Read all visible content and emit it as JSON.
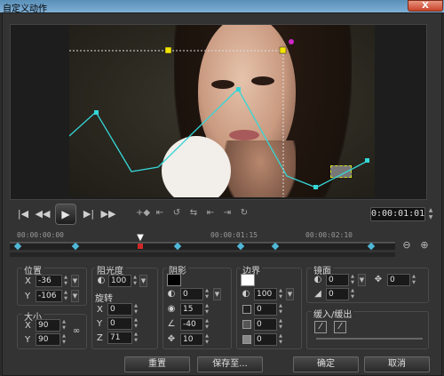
{
  "window": {
    "title": "自定义动作",
    "close_label": "X"
  },
  "transport": {
    "timecode": "0:00:01:01",
    "icons": [
      "skip-to-start-icon",
      "step-back-icon",
      "play-icon",
      "step-forward-icon",
      "skip-to-end-icon"
    ]
  },
  "timeline": {
    "ruler_labels": [
      "00:00:00:00",
      "00:00:01:15",
      "00:00:02:10"
    ],
    "keyframe_count": 8
  },
  "position": {
    "label": "位置",
    "x_axis": "X",
    "y_axis": "Y",
    "x": "-36",
    "y": "-106"
  },
  "size": {
    "label": "大小",
    "x_axis": "X",
    "y_axis": "Y",
    "x": "90",
    "y": "90"
  },
  "opacity": {
    "label": "阻光度",
    "value": "100"
  },
  "rotation": {
    "label": "旋转",
    "x_axis": "X",
    "y_axis": "Y",
    "z_axis": "Z",
    "x": "0",
    "y": "0",
    "z": "71"
  },
  "shadow": {
    "label": "阴影",
    "color": "#000000",
    "values": [
      "0",
      "15",
      "-40",
      "10"
    ]
  },
  "border": {
    "label": "边界",
    "color": "#ffffff",
    "values": [
      "100",
      "0",
      "0",
      "0"
    ]
  },
  "mirror": {
    "label": "镜面",
    "values": [
      "0",
      "0"
    ],
    "side_value": "0"
  },
  "fade": {
    "label": "缓入/缓出"
  },
  "buttons": {
    "reset": "重置",
    "save_as": "保存至...",
    "ok": "确定",
    "cancel": "取消"
  },
  "colors": {
    "path": "#35d6d6",
    "keyframe": "#4fb8d8",
    "handle": "#f2e400",
    "titlebar": "#6a9fc8"
  }
}
